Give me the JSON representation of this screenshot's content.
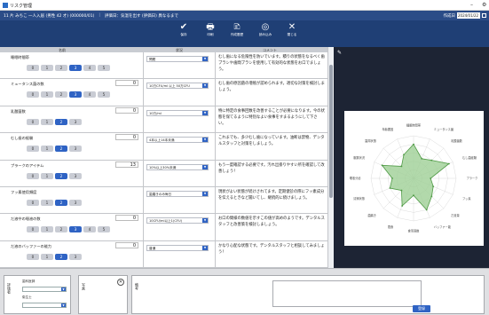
{
  "window": {
    "title": "リスク管理",
    "minimize": "–",
    "settings": "⚙"
  },
  "info": {
    "user": "11 片 みちこ 一人入居 (男性 42 才) (000000/01)",
    "sep": "|",
    "status": "評価日：気温を出す (評価日) 異なるまで",
    "date_label": "作成日",
    "date_value": "2024/01/22"
  },
  "toolbar": {
    "tools": [
      {
        "name": "save",
        "label": "保存",
        "icon": "✔"
      },
      {
        "name": "print",
        "label": "印刷",
        "icon": "🖶"
      },
      {
        "name": "history",
        "label": "作成履歴",
        "icon": "🗈"
      },
      {
        "name": "reading",
        "label": "読み込み",
        "icon": "◎"
      },
      {
        "name": "close",
        "label": "閉じる",
        "icon": "✕"
      }
    ]
  },
  "columns": {
    "name": "名前",
    "status": "状況",
    "comment": "コメント"
  },
  "rows": [
    {
      "name": "睡眠時間帯",
      "value": "",
      "dropdown": "問題",
      "selected": 3,
      "comment": "むし歯になる危険性を防いでいます。積りの状態をなるべく歯ブラシや歯間ブラシを使用して有効的な状態をお口でましょう。"
    },
    {
      "name": "ミュータンス菌の数",
      "value": "0",
      "dropdown": "10万CFU/ml 以上 50万CFU",
      "selected": 3,
      "comment": "むし歯の原因菌の増殖が認められます。適切な対策を検討しましょう。"
    },
    {
      "name": "乳酸菌数",
      "value": "0",
      "dropdown": "10万/ml",
      "selected": 2,
      "comment": "特に特定の食事回数を改善することが必要になります。今の状態を保てるように特別なよい食事をすまるようにして下さい。"
    },
    {
      "name": "むし歯の経験",
      "value": "0",
      "dropdown": "4本以上14本未満",
      "selected": 2,
      "comment": "これまでも、多少むし歯になっています。油断は禁物、デンタルスタッフと対策をしましょう。"
    },
    {
      "name": "プラークのアイテム",
      "value": "13",
      "dropdown": "10%以上30%未満",
      "selected": 2,
      "comment": "もう一度確認する必要です。汚れ出掛りやすい所を確認して改善しょう！"
    },
    {
      "name": "フッ素使用頻度",
      "value": "",
      "dropdown": "歯磨きのみ毎日",
      "selected": 2,
      "comment": "現状がよい状態が続けされてます。定期健診の際にフッ素成分を伝えるときなど聞いてし、継続的に続けましょう。"
    },
    {
      "name": "だ液中の唾液の数",
      "value": "0",
      "dropdown": "10CFU/ml以上1(CFU)",
      "selected": 3,
      "comment": "お口の間様の数値を示すこの値が高めのようです。デンタルスタッフと改善策を検討しましょう。"
    },
    {
      "name": "だ液のバッファーの能力",
      "value": "0",
      "dropdown": "普通",
      "selected": 2,
      "comment": "かなり心配な状態です。デンタルスタッフと相談してみましょう！"
    }
  ],
  "scale_labels": [
    "0",
    "1",
    "2",
    "3",
    "4",
    "5"
  ],
  "radar": {
    "labels": [
      "睡眠時間帯",
      "ミュータンス菌",
      "乳酸菌数",
      "むし歯経験",
      "プラーク",
      "フッ素",
      "だ液量",
      "バッファー能",
      "食事回数",
      "間食",
      "歯磨き",
      "清掃状態",
      "唾液分泌",
      "服薬状況",
      "歯周状態",
      "年齢要因"
    ],
    "max": 5,
    "values": [
      4,
      2.5,
      3,
      4.5,
      2,
      2.5,
      3,
      4,
      2,
      3.5,
      2,
      3,
      2.5,
      4,
      2,
      3
    ]
  },
  "bottom": {
    "left_label": "評価者",
    "dd1_label": "歯科医師",
    "dd2_label": "衛生士",
    "mid_label": "写真",
    "notes_label": "備考",
    "register": "登録"
  },
  "colors": {
    "accent": "#2f63c4",
    "toolbar": "#1f3f75",
    "panel": "#1d2434",
    "radar_fill": "#9fcf96",
    "radar_stroke": "#4f9a45"
  }
}
